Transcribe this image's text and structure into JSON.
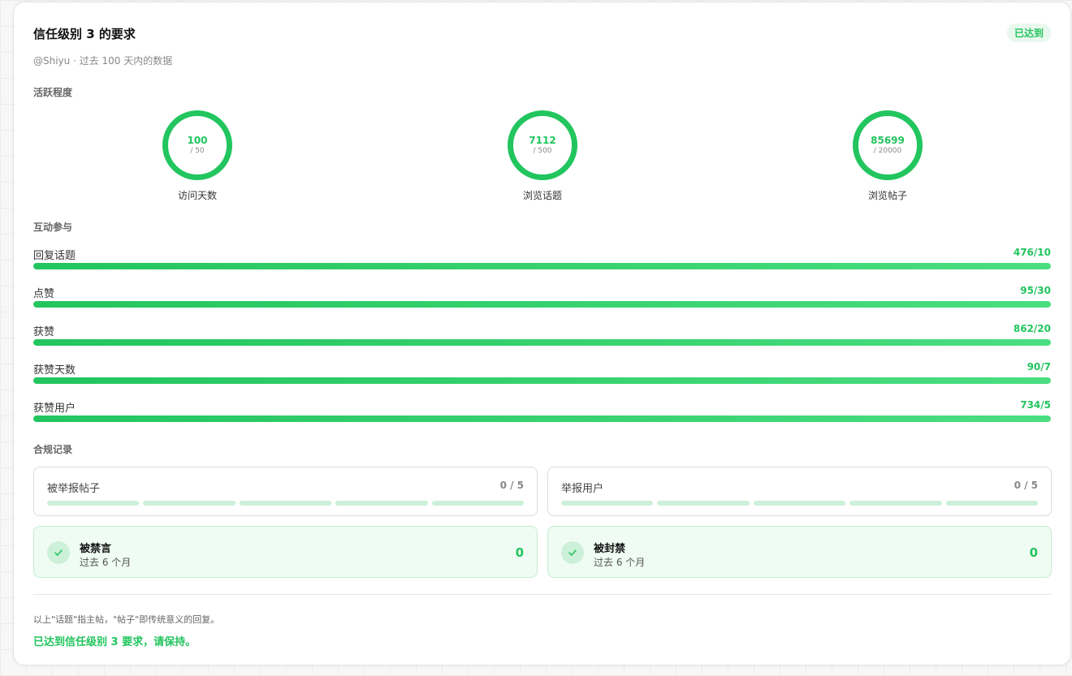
{
  "header": {
    "title": "信任级别 3 的要求",
    "badge": "已达到",
    "subtitle": "@Shiyu · 过去 100 天内的数据"
  },
  "activity": {
    "label": "活跃程度",
    "rings": [
      {
        "value": "100",
        "target": "/ 50",
        "label": "访问天数"
      },
      {
        "value": "7112",
        "target": "/ 500",
        "label": "浏览话题"
      },
      {
        "value": "85699",
        "target": "/ 20000",
        "label": "浏览帖子"
      }
    ]
  },
  "interaction": {
    "label": "互动参与",
    "bars": [
      {
        "label": "回复话题",
        "value": "476/10",
        "progress": 1.0
      },
      {
        "label": "点赞",
        "value": "95/30",
        "progress": 1.0
      },
      {
        "label": "获赞",
        "value": "862/20",
        "progress": 1.0
      },
      {
        "label": "获赞天数",
        "value": "90/7",
        "progress": 1.0
      },
      {
        "label": "获赞用户",
        "value": "734/5",
        "progress": 1.0
      }
    ]
  },
  "compliance": {
    "label": "合规记录",
    "boxes": [
      {
        "label": "被举报帖子",
        "value": "0 / 5"
      },
      {
        "label": "举报用户",
        "value": "0 / 5"
      }
    ],
    "statuses": [
      {
        "title": "被禁言",
        "sub": "过去 6 个月",
        "value": "0"
      },
      {
        "title": "被封禁",
        "sub": "过去 6 个月",
        "value": "0"
      }
    ]
  },
  "footer": {
    "note": "以上\"话题\"指主帖，\"帖子\"即传统意义的回复。",
    "result": "已达到信任级别 3 要求，请保持。"
  },
  "colors": {
    "accent": "#22c55e",
    "accent_light": "#dcf5e4",
    "status_bg": "#effcf3"
  }
}
